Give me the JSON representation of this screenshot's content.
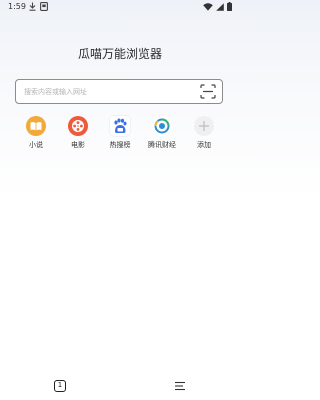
{
  "status_bar": {
    "time": "1:59",
    "left_icons": [
      "download-icon",
      "notification-icon"
    ],
    "right_icons": [
      "wifi-icon",
      "signal-icon",
      "battery-icon"
    ]
  },
  "app": {
    "title": "瓜喵万能浏览器"
  },
  "search": {
    "placeholder": "搜索内容或输入网址",
    "value": "",
    "scan_icon": "scan-icon"
  },
  "shortcuts": [
    {
      "label": "小说",
      "icon": "book-icon",
      "color": "#f0a93a"
    },
    {
      "label": "电影",
      "icon": "film-reel-icon",
      "color": "#ee5a3c"
    },
    {
      "label": "热搜榜",
      "icon": "baidu-paw-icon",
      "color": "#3b6ee8"
    },
    {
      "label": "腾讯财经",
      "icon": "tencent-news-icon",
      "color": "#2c8fd6"
    },
    {
      "label": "添加",
      "icon": "plus-icon",
      "color": "#d8d8d8"
    }
  ],
  "bottom_bar": {
    "tab_count": "1",
    "menu_icon": "menu-icon"
  }
}
